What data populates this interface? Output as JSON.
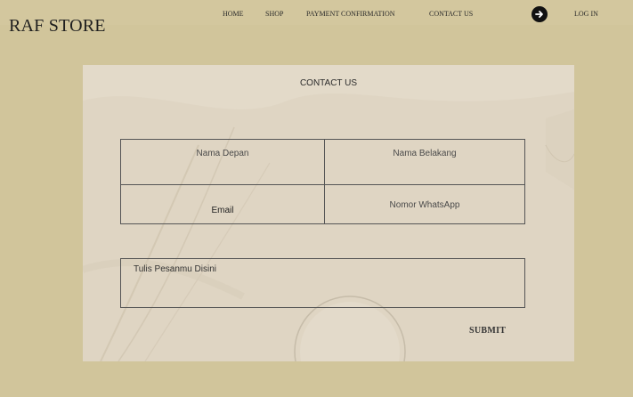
{
  "brand": {
    "name": "RAF STORE"
  },
  "nav": {
    "home": "HOME",
    "shop": "SHOP",
    "payment": "PAYMENT CONFIRMATION",
    "contact": "CONTACT US",
    "login": "LOG IN",
    "login_icon": "arrow-right-circle-icon"
  },
  "form": {
    "title": "CONTACT US",
    "first_name_placeholder": "Nama Depan",
    "last_name_placeholder": "Nama Belakang",
    "email_placeholder": "Email",
    "whatsapp_placeholder": "Nomor WhatsApp",
    "message_placeholder": "Tulis Pesanmu Disini",
    "submit_label": "SUBMIT"
  },
  "colors": {
    "page_bg": "#d1c59b",
    "panel_bg": "#e3dac9",
    "border": "#555555",
    "text": "#2b2b2b"
  }
}
